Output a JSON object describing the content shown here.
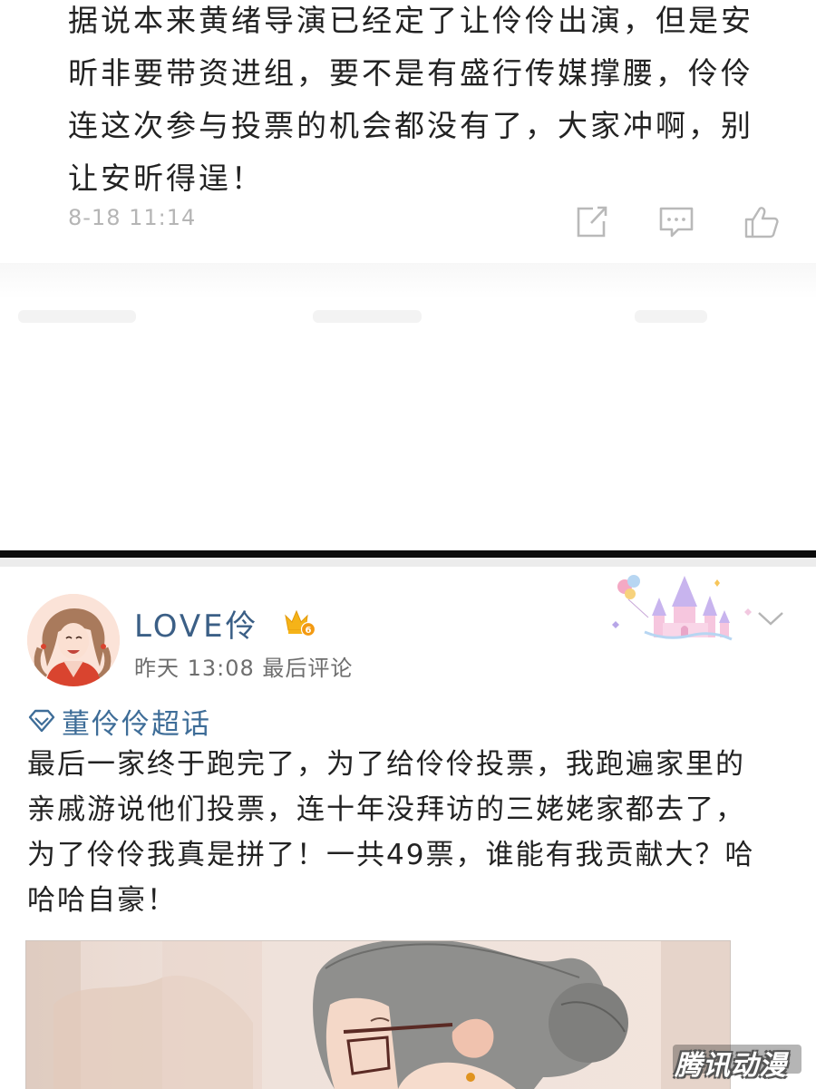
{
  "post1": {
    "lines": [
      "据说本来黄绪导演已经定了让伶伶出演，但是安",
      "昕非要带资进组，要不是有盛行传媒撑腰，伶伶",
      "连这次参与投票的机会都没有了，大家冲啊，别",
      "让安昕得逞！"
    ],
    "timestamp": "8-18 11:14",
    "actions": {
      "share_icon": "share-icon",
      "comment_icon": "comment-icon",
      "like_icon": "like-icon"
    }
  },
  "post2": {
    "username": "LOVE伶",
    "vip_level": "6",
    "time": "昨天 13:08 最后评论",
    "topic": "董伶伶超话",
    "lines": [
      "最后一家终于跑完了，为了给伶伶投票，我跑遍家里的",
      "亲戚游说他们投票，连十年没拜访的三姥姥家都去了，",
      "为了伶伶我真是拼了！一共49票，谁能有我贡献大？哈",
      "哈哈自豪！"
    ]
  },
  "watermark": "腾讯动漫",
  "colors": {
    "username": "#3b5f86",
    "topic": "#3e6d98",
    "meta": "#b5b5b5",
    "divider": "#0c0c0c"
  }
}
